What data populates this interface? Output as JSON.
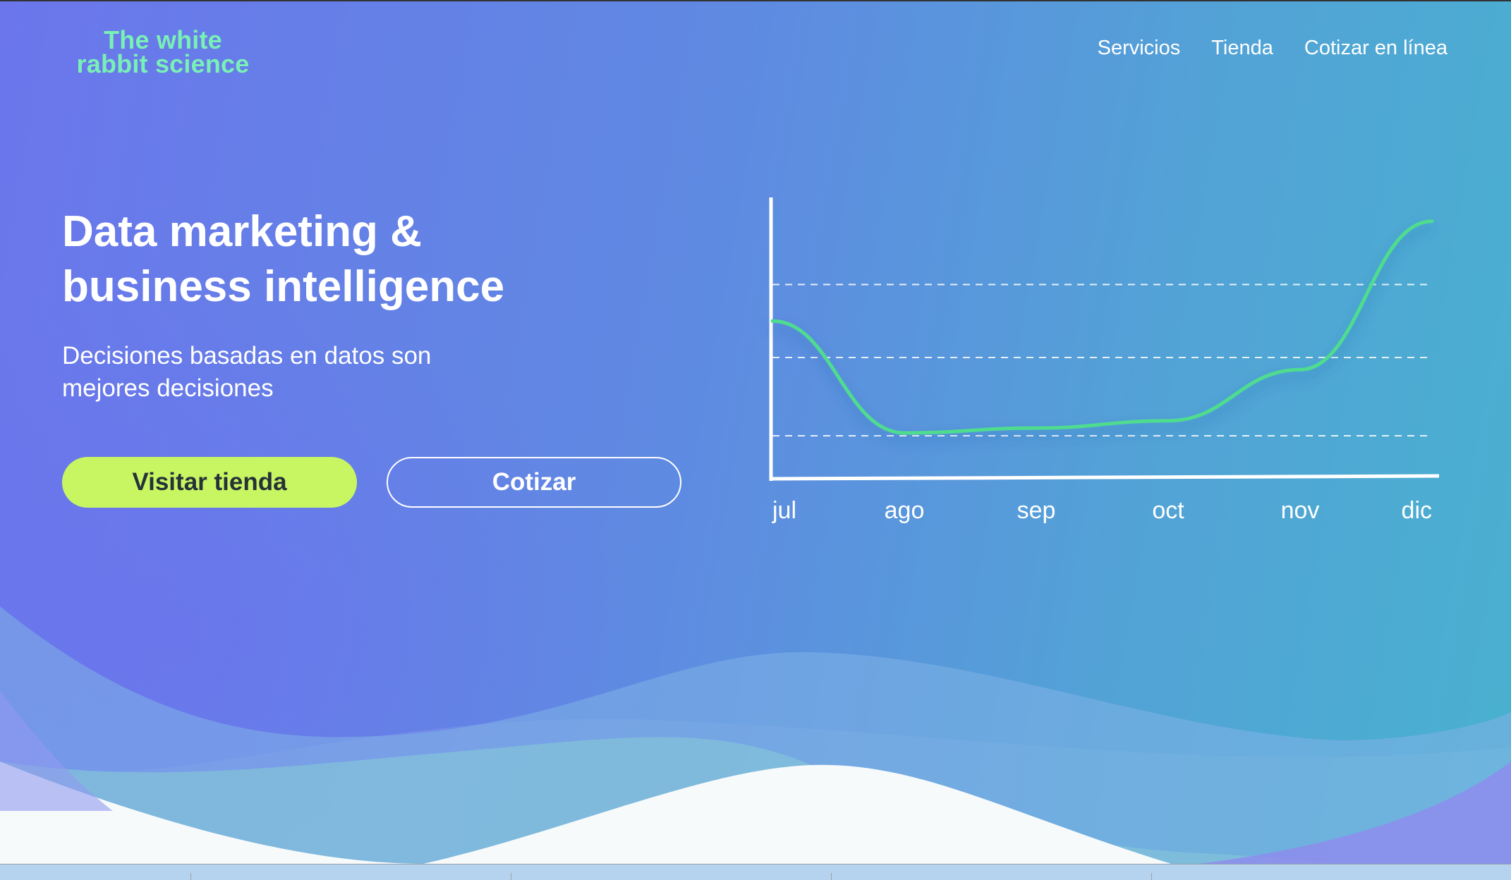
{
  "brand": {
    "name_line1": "The white",
    "name_line2": "rabbit science"
  },
  "nav": {
    "items": [
      "Servicios",
      "Tienda",
      "Cotizar en línea"
    ]
  },
  "hero": {
    "headline_line1": "Data marketing &",
    "headline_line2": "business intelligence",
    "subtitle_line1": "Decisiones basadas en datos son",
    "subtitle_line2": "mejores decisiones",
    "primary_button": "Visitar tienda",
    "secondary_button": "Cotizar"
  },
  "colors": {
    "brand": "#79f0b6",
    "primary_button": "#c8f662",
    "line": "#4fdc8f",
    "gradient_start": "#6b76ec",
    "gradient_end": "#49b1d0"
  },
  "chart_data": {
    "type": "line",
    "categories": [
      "jul",
      "ago",
      "sep",
      "oct",
      "nov",
      "dic"
    ],
    "series": [
      {
        "values": [
          55,
          9,
          11,
          14,
          35,
          96
        ]
      }
    ],
    "ylim": [
      0,
      100
    ],
    "grid": "horizontal dashed",
    "axis_ticks_y": false
  }
}
